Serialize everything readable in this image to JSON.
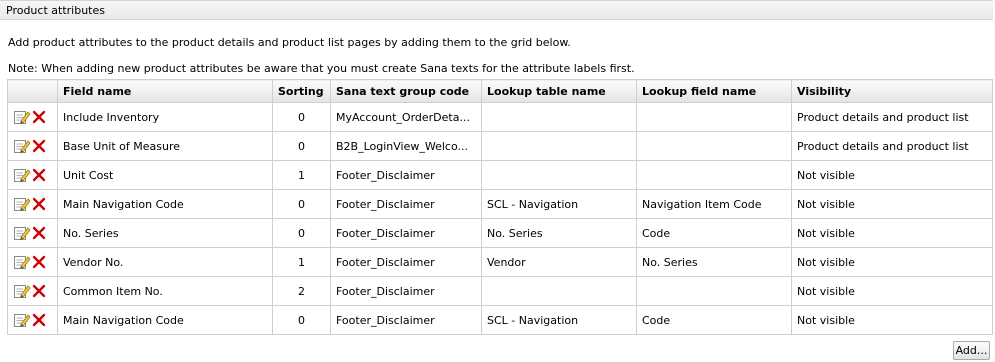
{
  "panel": {
    "title": "Product attributes"
  },
  "description": "Add product attributes to the product details and product list pages by adding them to the grid below.",
  "note": "Note: When adding new product attributes be aware that you must create Sana texts for the attribute labels first.",
  "grid": {
    "columns": [
      "Field name",
      "Sorting",
      "Sana text group code",
      "Lookup table name",
      "Lookup field name",
      "Visibility"
    ],
    "rows": [
      {
        "field": "Include Inventory",
        "sorting": "0",
        "group": "MyAccount_OrderDeta...",
        "lookup_table": "",
        "lookup_field": "",
        "visibility": "Product details and product list"
      },
      {
        "field": "Base Unit of Measure",
        "sorting": "0",
        "group": "B2B_LoginView_Welco...",
        "lookup_table": "",
        "lookup_field": "",
        "visibility": "Product details and product list"
      },
      {
        "field": "Unit Cost",
        "sorting": "1",
        "group": "Footer_Disclaimer",
        "lookup_table": "",
        "lookup_field": "",
        "visibility": "Not visible"
      },
      {
        "field": "Main Navigation Code",
        "sorting": "0",
        "group": "Footer_Disclaimer",
        "lookup_table": "SCL - Navigation",
        "lookup_field": "Navigation Item Code",
        "visibility": "Not visible"
      },
      {
        "field": "No. Series",
        "sorting": "0",
        "group": "Footer_Disclaimer",
        "lookup_table": "No. Series",
        "lookup_field": "Code",
        "visibility": "Not visible"
      },
      {
        "field": "Vendor No.",
        "sorting": "1",
        "group": "Footer_Disclaimer",
        "lookup_table": "Vendor",
        "lookup_field": "No. Series",
        "visibility": "Not visible"
      },
      {
        "field": "Common Item No.",
        "sorting": "2",
        "group": "Footer_Disclaimer",
        "lookup_table": "",
        "lookup_field": "",
        "visibility": "Not visible"
      },
      {
        "field": "Main Navigation Code",
        "sorting": "0",
        "group": "Footer_Disclaimer",
        "lookup_table": "SCL - Navigation",
        "lookup_field": "Code",
        "visibility": "Not visible"
      }
    ]
  },
  "icons": {
    "edit": "edit-icon",
    "delete": "delete-icon",
    "delete_color": "#cc0000"
  },
  "add_button": {
    "label": "Add..."
  }
}
